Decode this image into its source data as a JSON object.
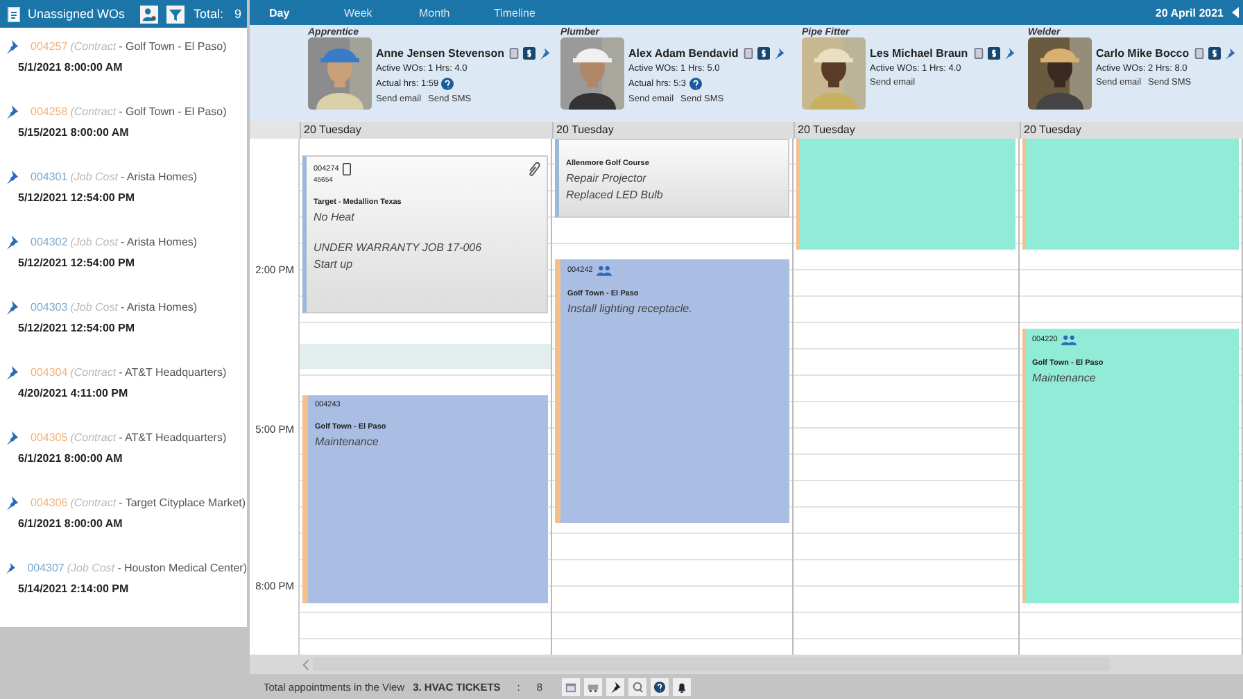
{
  "unassigned": {
    "title": "Unassigned WOs",
    "total_label": "Total:",
    "total": "9",
    "items": [
      {
        "kind": "contract",
        "number": "004257",
        "type": "(Contract",
        "client": "- Golf Town - El Paso)",
        "date": "5/1/2021 8:00:00 AM"
      },
      {
        "kind": "contract",
        "number": "004258",
        "type": "(Contract",
        "client": "- Golf Town - El Paso)",
        "date": "5/15/2021 8:00:00 AM"
      },
      {
        "kind": "job_cost",
        "number": "004301",
        "type": "(Job Cost",
        "client": "- Arista Homes)",
        "date": "5/12/2021 12:54:00 PM"
      },
      {
        "kind": "job_cost",
        "number": "004302",
        "type": "(Job Cost",
        "client": "- Arista Homes)",
        "date": "5/12/2021 12:54:00 PM"
      },
      {
        "kind": "job_cost",
        "number": "004303",
        "type": "(Job Cost",
        "client": "- Arista Homes)",
        "date": "5/12/2021 12:54:00 PM"
      },
      {
        "kind": "contract",
        "number": "004304",
        "type": "(Contract",
        "client": "- AT&T Headquarters)",
        "date": "4/20/2021 4:11:00 PM"
      },
      {
        "kind": "contract",
        "number": "004305",
        "type": "(Contract",
        "client": "- AT&T Headquarters)",
        "date": "6/1/2021 8:00:00 AM"
      },
      {
        "kind": "contract",
        "number": "004306",
        "type": "(Contract",
        "client": "- Target Cityplace Market)",
        "date": "6/1/2021 8:00:00 AM"
      },
      {
        "kind": "job_cost",
        "number": "004307",
        "type": "(Job Cost",
        "client": "- Houston Medical Center)",
        "date": "5/14/2021 2:14:00 PM"
      }
    ]
  },
  "views": [
    {
      "label": "Day",
      "selected": true
    },
    {
      "label": "Week",
      "selected": false
    },
    {
      "label": "Month",
      "selected": false
    },
    {
      "label": "Timeline",
      "selected": false
    }
  ],
  "date": "20 April 2021",
  "times": [
    "2:00 PM",
    "5:00 PM",
    "8:00 PM"
  ],
  "columns": [
    {
      "role": "Apprentice",
      "name": "Anne Jensen Stevenson",
      "active": "Active WOs: 1 Hrs: 4.0",
      "actual": "Actual hrs: 1:59",
      "actions": [
        "Send email",
        "Send SMS"
      ],
      "day": "20 Tuesday",
      "appointments": [
        {
          "kind": "note",
          "number": "004274",
          "mobile": true,
          "attachment": true,
          "code": "45654",
          "client": "Target - Medallion Texas",
          "lines": [
            "No Heat"
          ],
          "notes": [
            "UNDER WARRANTY JOB 17-006",
            "Start up"
          ]
        },
        {
          "kind": "band"
        },
        {
          "kind": "job",
          "number": "004243",
          "client": "Golf Town - El Paso",
          "lines": [
            "Maintenance"
          ]
        }
      ]
    },
    {
      "role": "Plumber",
      "name": "Alex Adam Bendavid",
      "active": "Active WOs: 1 Hrs: 5.0",
      "actual": "Actual hrs: 5:3",
      "actions": [
        "Send email",
        "Send SMS"
      ],
      "day": "20 Tuesday",
      "appointments": [
        {
          "kind": "note",
          "client": "Allenmore Golf Course",
          "lines": [
            "Repair Projector",
            "Replaced LED Bulb"
          ]
        },
        {
          "kind": "job",
          "number": "004242",
          "crew": true,
          "client": "Golf Town - El Paso",
          "lines": [
            "Install lighting receptacle."
          ]
        }
      ]
    },
    {
      "role": "Pipe Fitter",
      "name": "Les Michael Braun",
      "active": "Active WOs: 1 Hrs: 4.0",
      "actions": [
        "Send email"
      ],
      "day": "20 Tuesday",
      "appointments": [
        {
          "kind": "teal"
        }
      ]
    },
    {
      "role": "Welder",
      "name": "Carlo Mike Bocco",
      "active": "Active WOs: 2 Hrs: 8.0",
      "actions": [
        "Send email",
        "Send SMS"
      ],
      "day": "20 Tuesday",
      "appointments": [
        {
          "kind": "teal"
        },
        {
          "kind": "teal",
          "number": "004220",
          "crew": true,
          "client": "Golf Town - El Paso",
          "lines": [
            "Maintenance"
          ]
        }
      ]
    }
  ],
  "status_bar": {
    "label": "Total appointments in the View",
    "view": "3. HVAC TICKETS",
    "separator": ":",
    "count": "8"
  }
}
